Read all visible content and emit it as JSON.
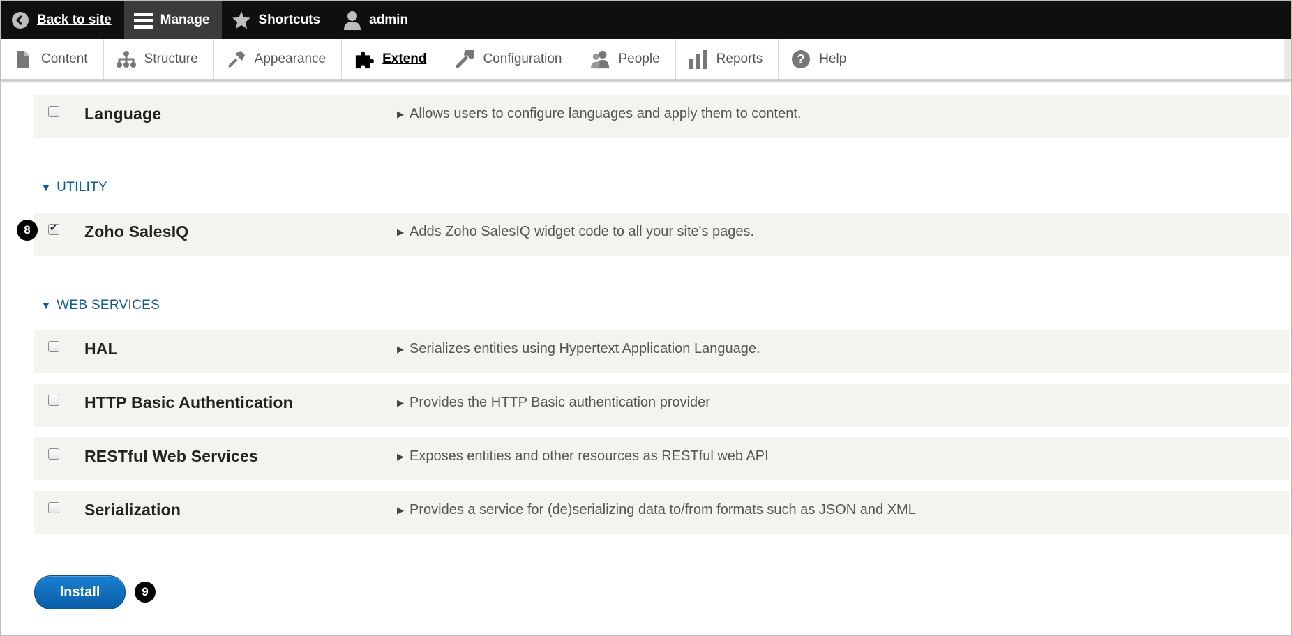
{
  "toolbar": {
    "back": "Back to site",
    "manage": "Manage",
    "shortcuts": "Shortcuts",
    "user": "admin"
  },
  "tray": {
    "items": [
      {
        "label": "Content",
        "icon": "file-icon"
      },
      {
        "label": "Structure",
        "icon": "sitemap-icon"
      },
      {
        "label": "Appearance",
        "icon": "paintbrush-icon"
      },
      {
        "label": "Extend",
        "icon": "puzzle-icon",
        "active": true
      },
      {
        "label": "Configuration",
        "icon": "wrench-icon"
      },
      {
        "label": "People",
        "icon": "people-icon"
      },
      {
        "label": "Reports",
        "icon": "bar-chart-icon"
      },
      {
        "label": "Help",
        "icon": "question-icon"
      }
    ]
  },
  "modules": {
    "language": {
      "name": "Language",
      "desc": "Allows users to configure languages and apply them to content.",
      "checked": false
    },
    "utility_header": "UTILITY",
    "zoho": {
      "name": "Zoho SalesIQ",
      "desc": "Adds Zoho SalesIQ widget code to all your site's pages.",
      "checked": true
    },
    "webservices_header": "WEB SERVICES",
    "hal": {
      "name": "HAL",
      "desc": "Serializes entities using Hypertext Application Language.",
      "checked": false
    },
    "http_basic": {
      "name": "HTTP Basic Authentication",
      "desc": "Provides the HTTP Basic authentication provider",
      "checked": false
    },
    "rest": {
      "name": "RESTful Web Services",
      "desc": "Exposes entities and other resources as RESTful web API",
      "checked": false
    },
    "serialization": {
      "name": "Serialization",
      "desc": "Provides a service for (de)serializing data to/from formats such as JSON and XML",
      "checked": false
    }
  },
  "badges": {
    "step8": "8",
    "step9": "9"
  },
  "install_label": "Install",
  "colors": {
    "accent": "#0a5ea8",
    "section_link": "#1a5a8a",
    "row_bg": "#f3f3ef",
    "toolbar_bg": "#0f0f0f"
  }
}
